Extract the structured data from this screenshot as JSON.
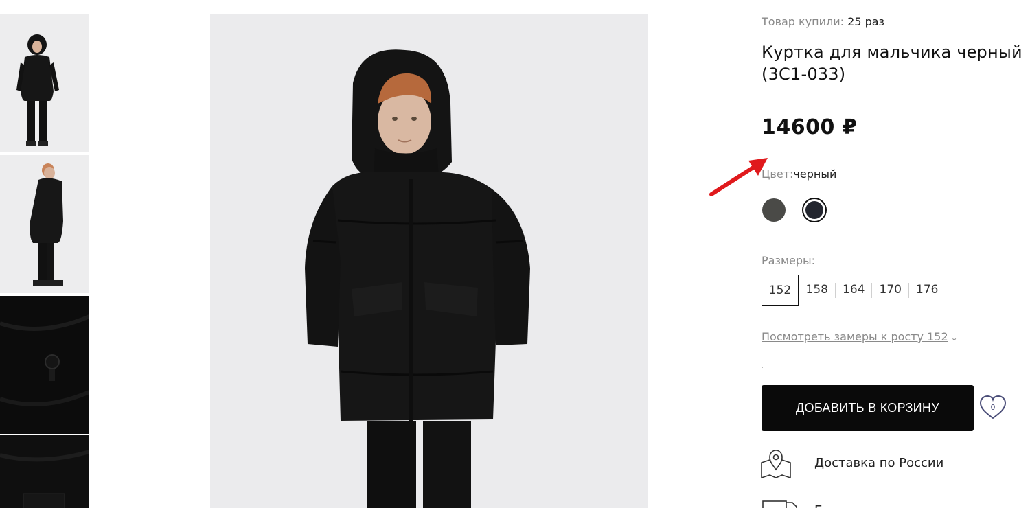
{
  "thumbnails": [
    {
      "name": "thumb-front"
    },
    {
      "name": "thumb-side"
    },
    {
      "name": "thumb-detail-toggle"
    },
    {
      "name": "thumb-detail-label"
    }
  ],
  "product": {
    "bought_label": "Товар купили:",
    "bought_count": "25 раз",
    "title": "Куртка для мальчика черный (3С1-033)",
    "price": "14600 ₽",
    "color_label": "Цвет:",
    "color_value": "черный",
    "colors": [
      {
        "name": "graphite",
        "hex": "#4a4a47",
        "selected": false
      },
      {
        "name": "black",
        "hex": "#23262f",
        "selected": true
      }
    ],
    "sizes_label": "Размеры:",
    "sizes": [
      "152",
      "158",
      "164",
      "170",
      "176"
    ],
    "selected_size": "152",
    "measure_link": "Посмотреть замеры к росту 152",
    "add_to_cart": "ДОБАВИТЬ В КОРЗИНУ",
    "favorites_count": "0",
    "delivery_text": "Доставка по России",
    "next_feature_text": "Б"
  },
  "colors": {
    "accent_arrow": "#e0191c",
    "button_bg": "#0a0a0a",
    "muted_text": "#8a8a8a",
    "heart": "#4a4d78"
  }
}
